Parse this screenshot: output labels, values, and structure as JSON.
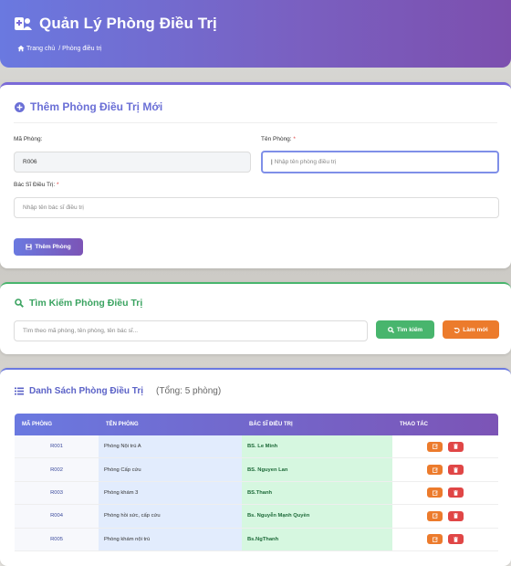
{
  "header": {
    "title": "Quản Lý Phòng Điều Trị",
    "breadcrumb": {
      "home": "Trang chủ",
      "current": "/ Phòng điều trị"
    }
  },
  "add_form": {
    "title": "Thêm Phòng Điều Trị Mới",
    "room_code_label": "Mã Phòng:",
    "room_code_value": "R006",
    "room_name_label": "Tên Phòng:",
    "room_name_placeholder": "Nhập tên phòng điều trị",
    "doctor_label": "Bác Sĩ Điều Trị:",
    "doctor_placeholder": "Nhập tên bác sĩ điều trị",
    "required_mark": "*",
    "submit_label": "Thêm Phòng"
  },
  "search": {
    "title": "Tìm Kiếm Phòng Điều Trị",
    "placeholder": "Tìm theo mã phòng, tên phòng, tên bác sĩ...",
    "find_label": "Tìm kiếm",
    "reset_label": "Làm mới"
  },
  "list": {
    "title": "Danh Sách Phòng Điều Trị",
    "count": "(Tổng: 5 phòng)",
    "columns": [
      "MÃ PHÒNG",
      "TÊN PHÒNG",
      "BÁC SĨ ĐIỀU TRỊ",
      "THAO TÁC"
    ],
    "rows": [
      {
        "code": "R001",
        "name": "Phòng Nội trú A",
        "doctor": "BS. Le Minh"
      },
      {
        "code": "R002",
        "name": "Phòng Cấp cứu",
        "doctor": "BS. Nguyen Lan"
      },
      {
        "code": "R003",
        "name": "Phòng khám 3",
        "doctor": "BS.Thanh"
      },
      {
        "code": "R004",
        "name": "Phòng hồi sức, cấp cứu",
        "doctor": "Bs. Nguyễn Mạnh Quyền"
      },
      {
        "code": "R005",
        "name": "Phòng khám nội trú",
        "doctor": "Bs.NgThanh"
      }
    ]
  },
  "colors": {
    "brand": "#6a79e0",
    "success": "#48b56d",
    "warning": "#ec7b2c",
    "danger": "#e04646"
  }
}
